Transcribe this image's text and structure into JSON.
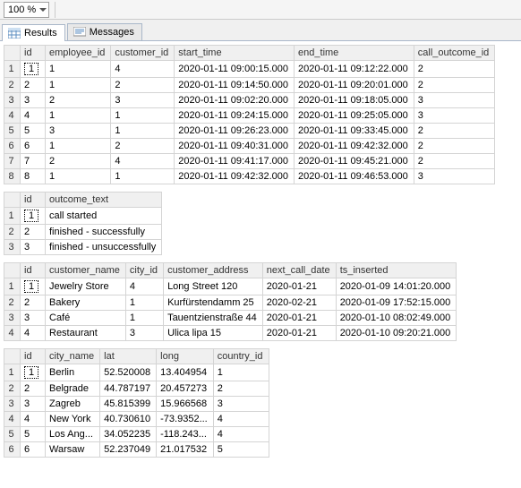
{
  "toolbar": {
    "zoom": "100 %"
  },
  "tabs": {
    "results": "Results",
    "messages": "Messages"
  },
  "grids": [
    {
      "columns": [
        "id",
        "employee_id",
        "customer_id",
        "start_time",
        "end_time",
        "call_outcome_id"
      ],
      "rows": [
        [
          "1",
          "1",
          "4",
          "2020-01-11 09:00:15.000",
          "2020-01-11 09:12:22.000",
          "2"
        ],
        [
          "2",
          "1",
          "2",
          "2020-01-11 09:14:50.000",
          "2020-01-11 09:20:01.000",
          "2"
        ],
        [
          "3",
          "2",
          "3",
          "2020-01-11 09:02:20.000",
          "2020-01-11 09:18:05.000",
          "3"
        ],
        [
          "4",
          "1",
          "1",
          "2020-01-11 09:24:15.000",
          "2020-01-11 09:25:05.000",
          "3"
        ],
        [
          "5",
          "3",
          "1",
          "2020-01-11 09:26:23.000",
          "2020-01-11 09:33:45.000",
          "2"
        ],
        [
          "6",
          "1",
          "2",
          "2020-01-11 09:40:31.000",
          "2020-01-11 09:42:32.000",
          "2"
        ],
        [
          "7",
          "2",
          "4",
          "2020-01-11 09:41:17.000",
          "2020-01-11 09:45:21.000",
          "2"
        ],
        [
          "8",
          "1",
          "1",
          "2020-01-11 09:42:32.000",
          "2020-01-11 09:46:53.000",
          "3"
        ]
      ]
    },
    {
      "columns": [
        "id",
        "outcome_text"
      ],
      "rows": [
        [
          "1",
          "call started"
        ],
        [
          "2",
          "finished - successfully"
        ],
        [
          "3",
          "finished - unsuccessfully"
        ]
      ]
    },
    {
      "columns": [
        "id",
        "customer_name",
        "city_id",
        "customer_address",
        "next_call_date",
        "ts_inserted"
      ],
      "rows": [
        [
          "1",
          "Jewelry Store",
          "4",
          "Long Street 120",
          "2020-01-21",
          "2020-01-09 14:01:20.000"
        ],
        [
          "2",
          "Bakery",
          "1",
          "Kurfürstendamm 25",
          "2020-02-21",
          "2020-01-09 17:52:15.000"
        ],
        [
          "3",
          "Café",
          "1",
          "Tauentzienstraße 44",
          "2020-01-21",
          "2020-01-10 08:02:49.000"
        ],
        [
          "4",
          "Restaurant",
          "3",
          "Ulica lipa 15",
          "2020-01-21",
          "2020-01-10 09:20:21.000"
        ]
      ]
    },
    {
      "columns": [
        "id",
        "city_name",
        "lat",
        "long",
        "country_id"
      ],
      "rows": [
        [
          "1",
          "Berlin",
          "52.520008",
          "13.404954",
          "1"
        ],
        [
          "2",
          "Belgrade",
          "44.787197",
          "20.457273",
          "2"
        ],
        [
          "3",
          "Zagreb",
          "45.815399",
          "15.966568",
          "3"
        ],
        [
          "4",
          "New York",
          "40.730610",
          "-73.9352...",
          "4"
        ],
        [
          "5",
          "Los Ang...",
          "34.052235",
          "-118.243...",
          "4"
        ],
        [
          "6",
          "Warsaw",
          "52.237049",
          "21.017532",
          "5"
        ]
      ]
    }
  ]
}
